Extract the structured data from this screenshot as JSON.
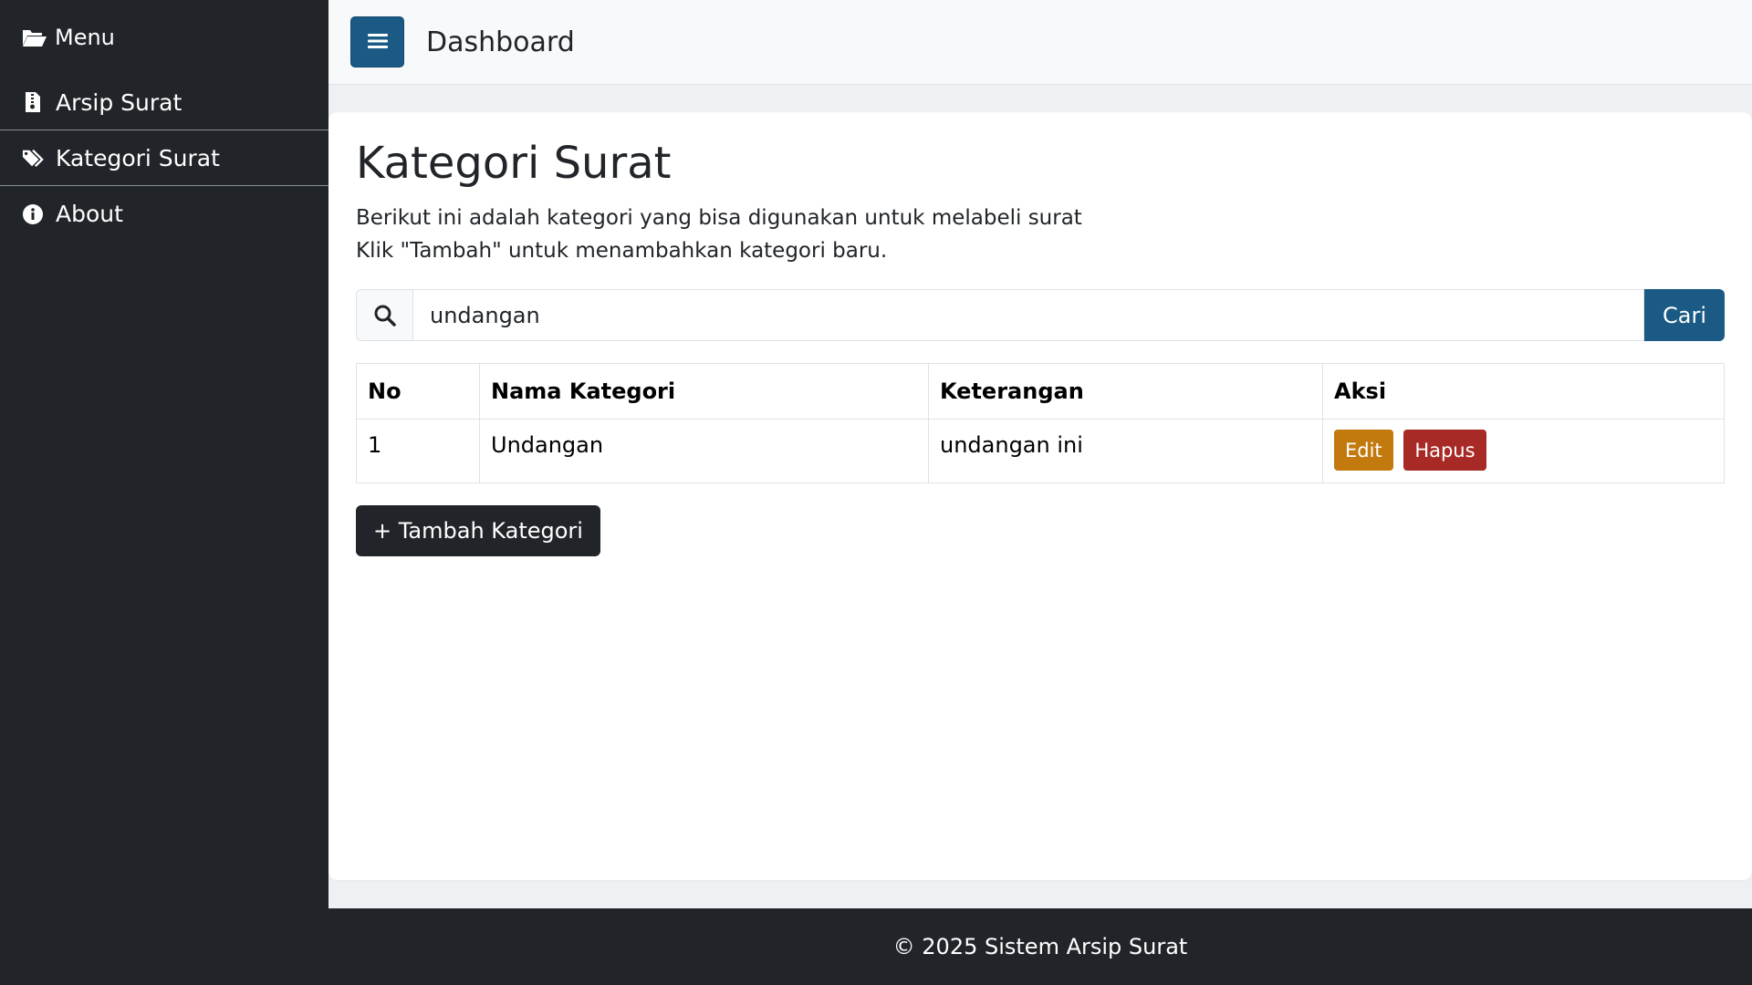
{
  "sidebar": {
    "header": {
      "icon": "folder-open-icon",
      "label": "Menu"
    },
    "items": [
      {
        "icon": "file-archive-icon",
        "label": "Arsip Surat"
      },
      {
        "icon": "tags-icon",
        "label": "Kategori Surat"
      },
      {
        "icon": "info-circle-icon",
        "label": "About"
      }
    ]
  },
  "topbar": {
    "toggle_icon": "hamburger-icon",
    "title": "Dashboard"
  },
  "main": {
    "title": "Kategori Surat",
    "description_line1": "Berikut ini adalah kategori yang bisa digunakan untuk melabeli surat",
    "description_line2": "Klik \"Tambah\" untuk menambahkan kategori baru.",
    "search": {
      "icon": "search-icon",
      "value": "undangan",
      "button_label": "Cari"
    },
    "table": {
      "headers": [
        "No",
        "Nama Kategori",
        "Keterangan",
        "Aksi"
      ],
      "rows": [
        {
          "no": "1",
          "nama": "Undangan",
          "keterangan": "undangan ini",
          "edit_label": "Edit",
          "hapus_label": "Hapus"
        }
      ]
    },
    "add_button_label": "+ Tambah Kategori"
  },
  "footer": {
    "text": "© 2025 Sistem Arsip Surat"
  },
  "colors": {
    "sidebar_bg": "#212529",
    "primary": "#1a5a85",
    "edit": "#c27a0e",
    "delete": "#a82a27"
  }
}
